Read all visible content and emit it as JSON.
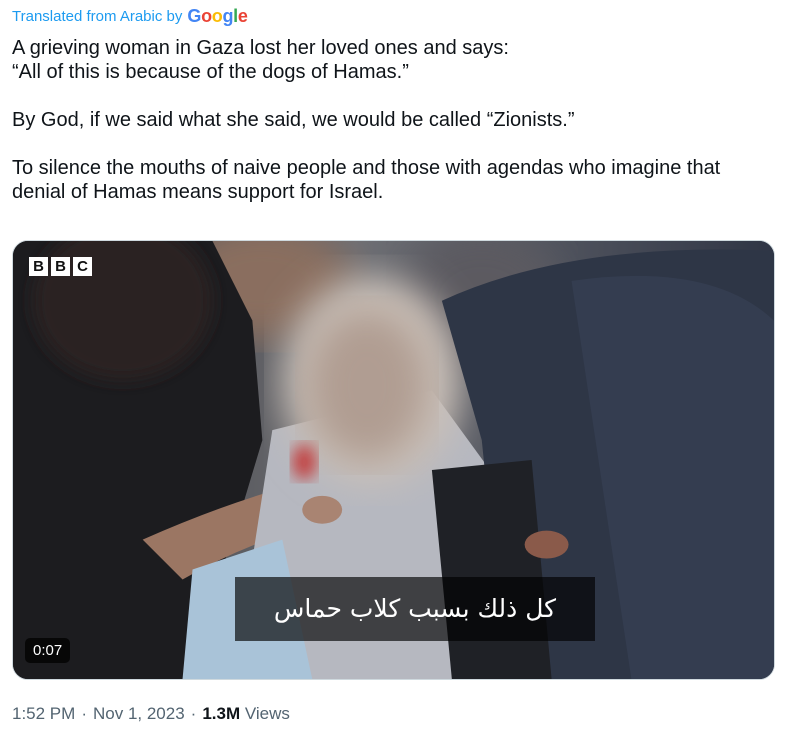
{
  "translation": {
    "label": "Translated from Arabic by",
    "provider": "Google",
    "provider_colors": [
      "#4285F4",
      "#EA4335",
      "#FBBC05",
      "#4285F4",
      "#34A853",
      "#EA4335"
    ]
  },
  "tweet": {
    "paragraphs": [
      "A grieving woman in Gaza lost her loved ones and says:\n“All of this is because of the dogs of Hamas.”",
      "By God, if we said what she said, we would be called “Zionists.”",
      "To silence the mouths of naive people and those with agendas who imagine that denial of Hamas means support for Israel."
    ]
  },
  "media": {
    "brand_letters": [
      "B",
      "B",
      "C"
    ],
    "subtitle": "كل ذلك بسبب كلاب حماس",
    "duration": "0:07"
  },
  "meta": {
    "time": "1:52 PM",
    "date": "Nov 1, 2023",
    "views_count": "1.3M",
    "views_label": "Views",
    "separator": "·"
  },
  "colors": {
    "link": "#1d9bf0",
    "text": "#0f1419",
    "muted": "#536471"
  }
}
